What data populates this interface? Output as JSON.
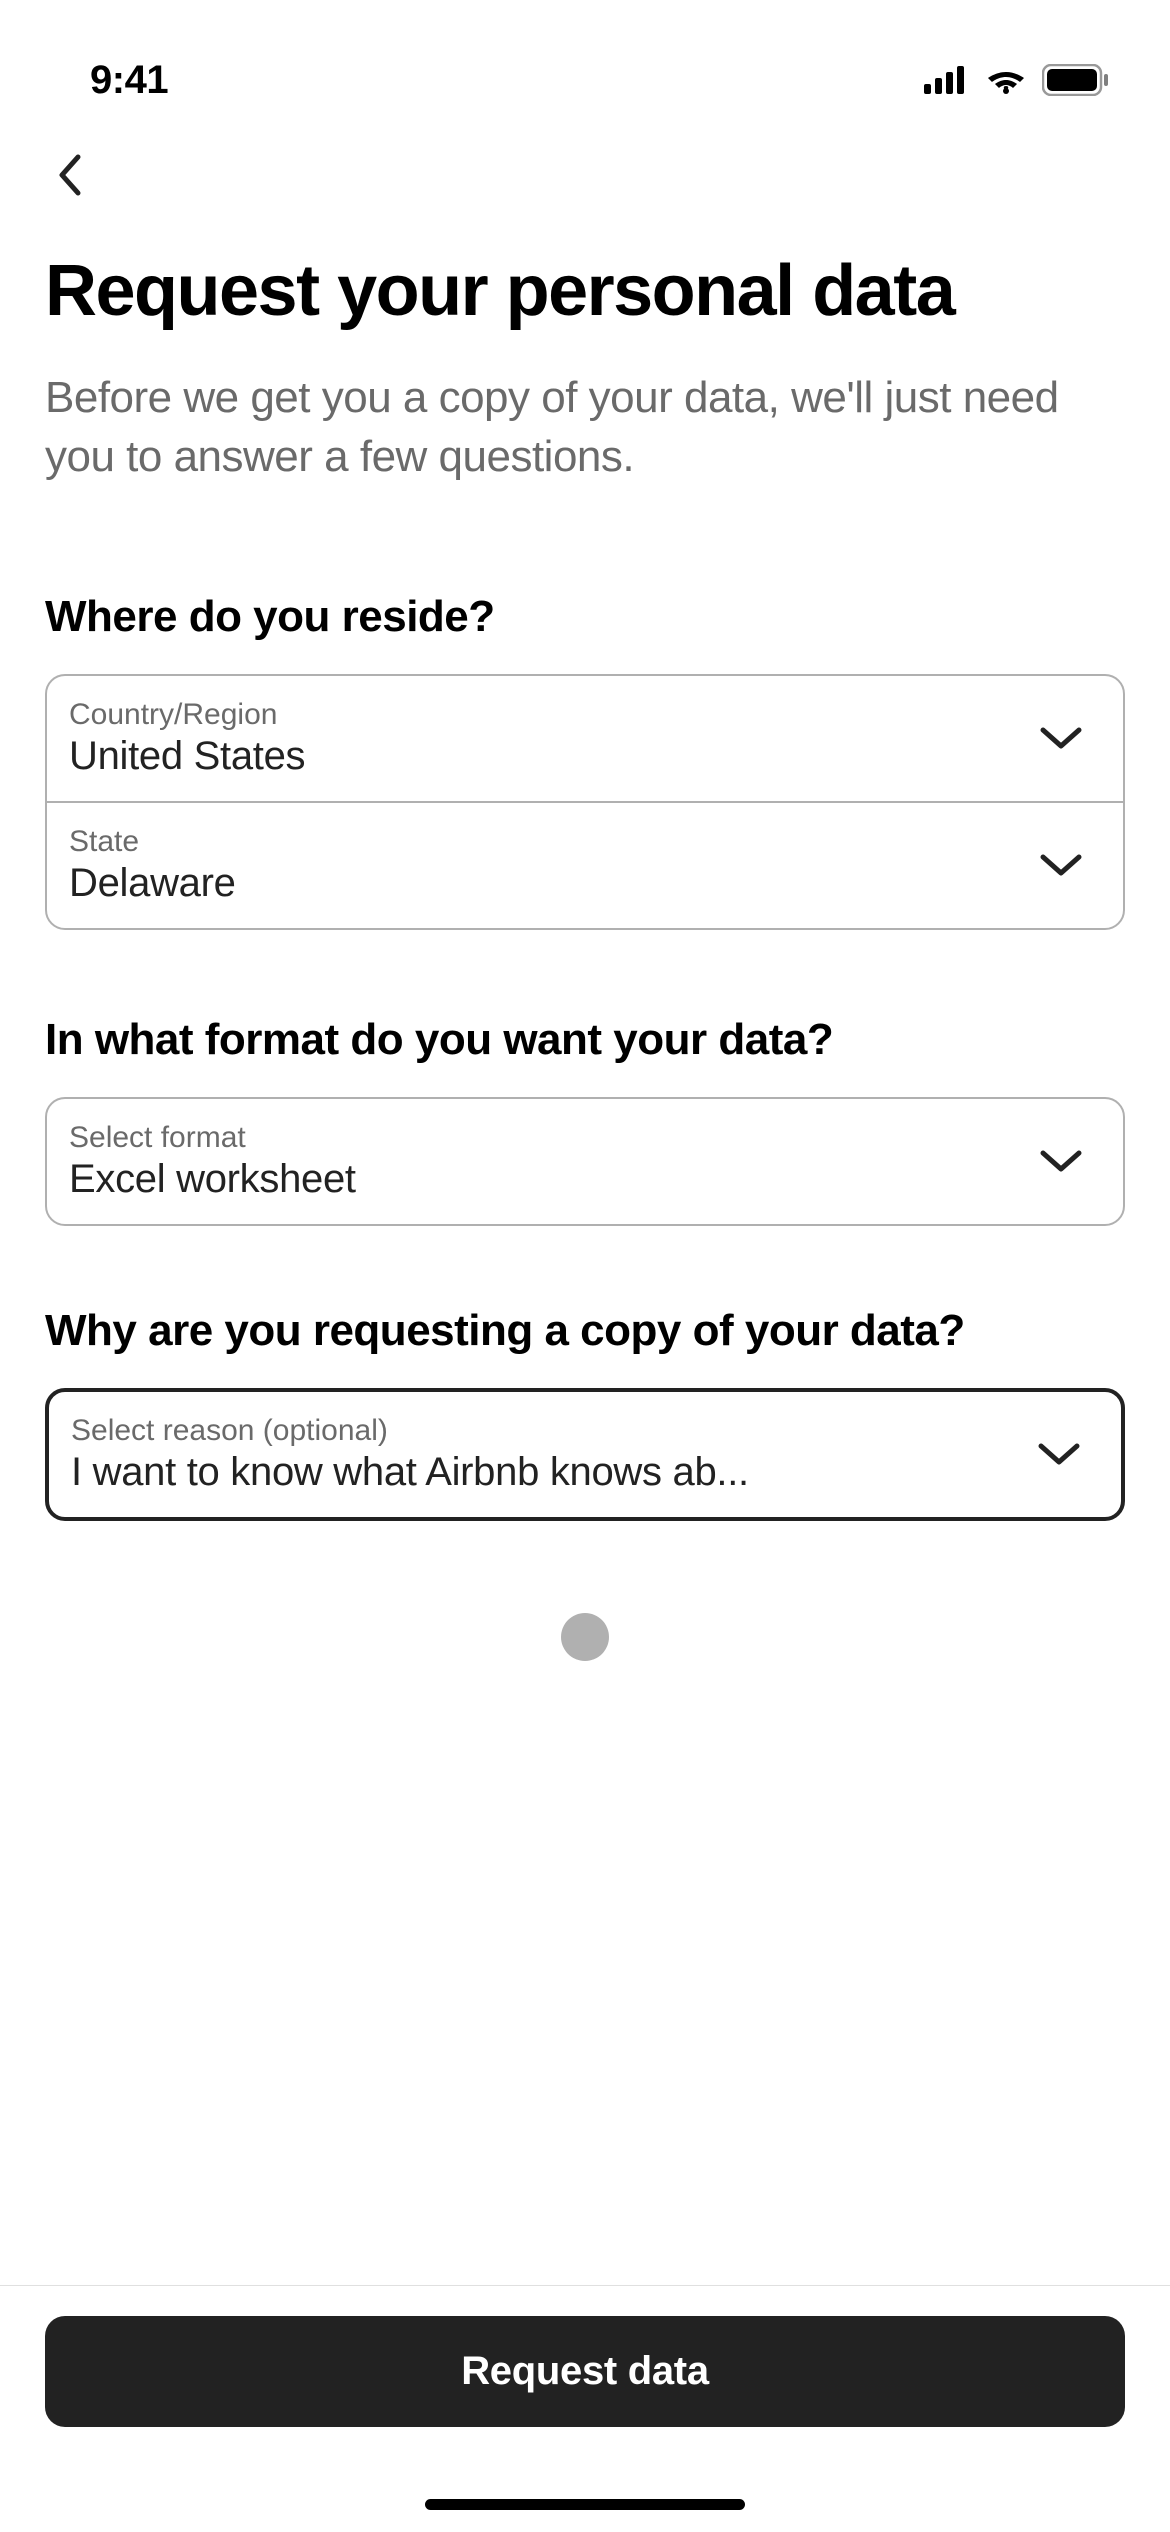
{
  "status": {
    "time": "9:41"
  },
  "page": {
    "title": "Request your personal data",
    "subtitle": "Before we get you a copy of your data, we'll just need you to answer a few questions."
  },
  "sections": {
    "reside": {
      "heading": "Where do you reside?",
      "country": {
        "label": "Country/Region",
        "value": "United States"
      },
      "state": {
        "label": "State",
        "value": "Delaware"
      }
    },
    "format": {
      "heading": "In what format do you want your data?",
      "select": {
        "label": "Select format",
        "value": "Excel worksheet"
      }
    },
    "reason": {
      "heading": "Why are you requesting a copy of your data?",
      "select": {
        "label": "Select reason (optional)",
        "value": "I want to know what Airbnb knows ab..."
      }
    }
  },
  "footer": {
    "submit_label": "Request data"
  }
}
